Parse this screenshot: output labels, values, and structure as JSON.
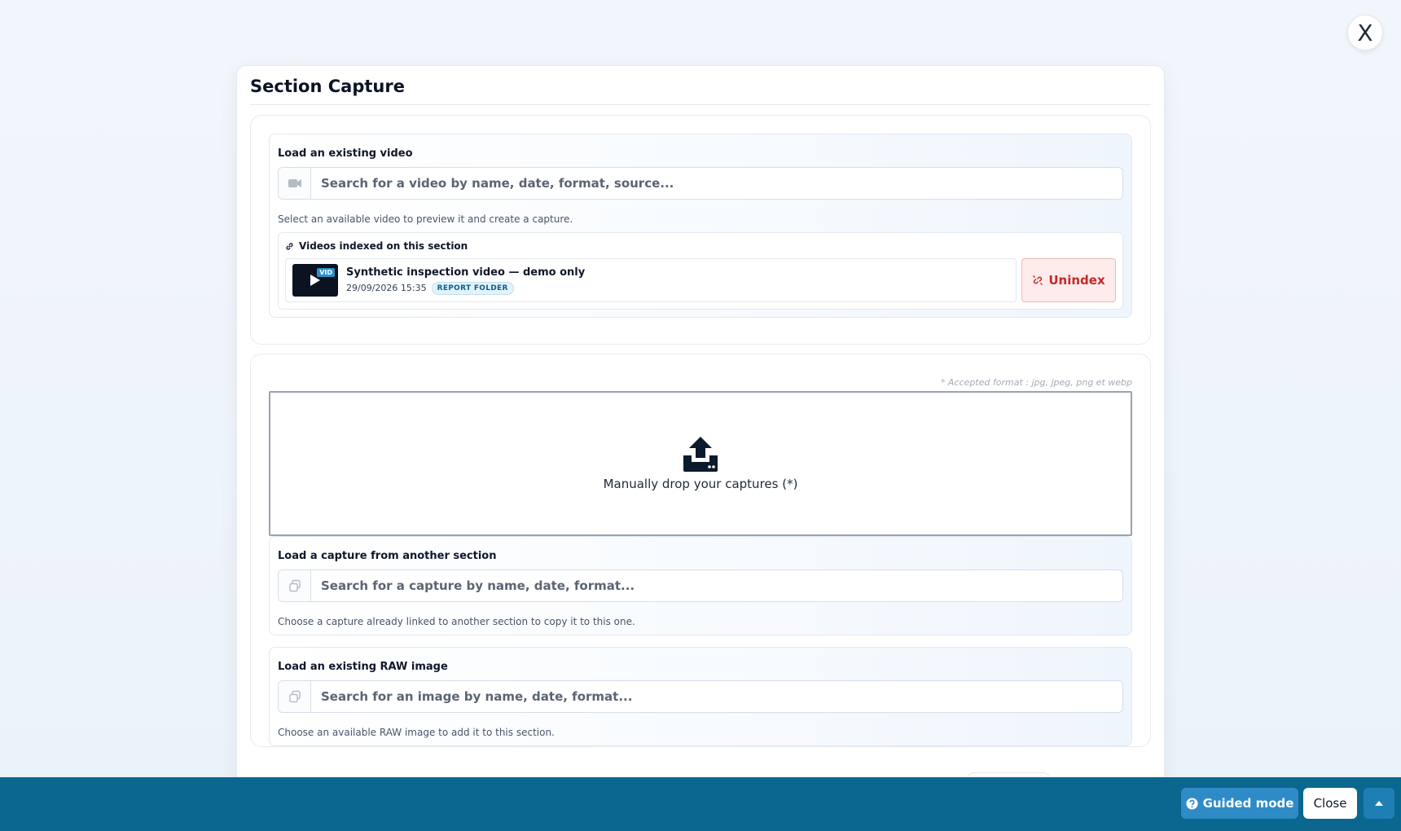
{
  "window": {
    "close_glyph": "X"
  },
  "modal": {
    "title": "Section Capture"
  },
  "video_search": {
    "label": "Load an existing video",
    "placeholder": "Search for a video by name, date, format, source...",
    "help": "Select an available video to preview it and create a capture."
  },
  "indexed_videos": {
    "heading": "Videos indexed on this section",
    "items": [
      {
        "name": "Synthetic inspection video — demo only",
        "date": "29/09/2026 15:35",
        "tag": "REPORT FOLDER",
        "thumb_badge": "VID"
      }
    ],
    "unindex_label": "Unindex"
  },
  "dropzone": {
    "accepted_formats": "* Accepted format : jpg, jpeg, png et webp",
    "text": "Manually drop your captures (*)"
  },
  "capture_search": {
    "label": "Load a capture from another section",
    "placeholder": "Search for a capture by name, date, format...",
    "help": "Choose a capture already linked to another section to copy it to this one."
  },
  "raw_search": {
    "label": "Load an existing RAW image",
    "placeholder": "Search for an image by name, date, format...",
    "help": "Choose an available RAW image to add it to this section."
  },
  "footer": {
    "guided_label": "Guided mode",
    "close_label": "Close"
  },
  "colors": {
    "footer_bg": "#0b678f",
    "guided_bg": "#2e8bc6",
    "unindex_text": "#c62828",
    "tag_text": "#0b5f8a"
  }
}
